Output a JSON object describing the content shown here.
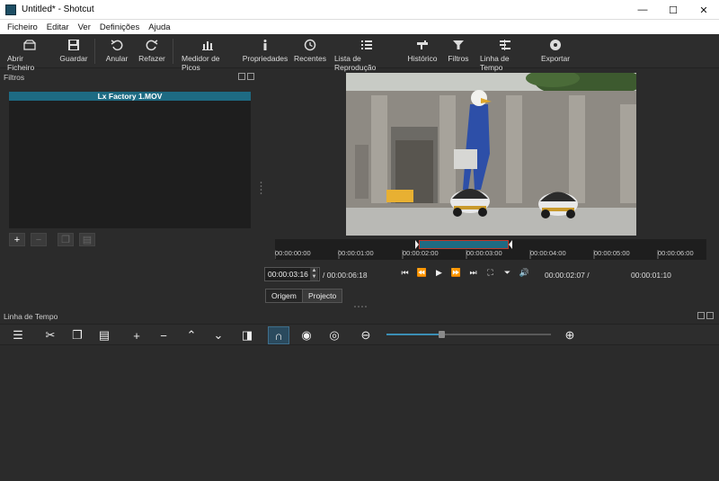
{
  "window": {
    "title": "Untitled* - Shotcut",
    "minimize": "—",
    "maximize": "☐",
    "close": "✕"
  },
  "menu": {
    "items": [
      "Ficheiro",
      "Editar",
      "Ver",
      "Definições",
      "Ajuda"
    ]
  },
  "toolbar": {
    "items": [
      {
        "label": "Abrir Ficheiro",
        "icon": "open-file-icon"
      },
      {
        "label": "Guardar",
        "icon": "save-icon"
      },
      {
        "label": "Anular",
        "icon": "undo-icon"
      },
      {
        "label": "Refazer",
        "icon": "redo-icon"
      },
      {
        "label": "Medidor de Picos",
        "icon": "peak-meter-icon"
      },
      {
        "label": "Propriedades",
        "icon": "properties-icon"
      },
      {
        "label": "Recentes",
        "icon": "recent-icon"
      },
      {
        "label": "Lista de Reprodução",
        "icon": "playlist-icon"
      },
      {
        "label": "Histórico",
        "icon": "history-icon"
      },
      {
        "label": "Filtros",
        "icon": "filter-icon"
      },
      {
        "label": "Linha de Tempo",
        "icon": "timeline-icon"
      },
      {
        "label": "Exportar",
        "icon": "export-icon"
      }
    ]
  },
  "filters_panel": {
    "title": "Filtros",
    "clip_name": "Lx Factory 1.MOV"
  },
  "player": {
    "ruler_labels": [
      "00:00:00:00",
      "00:00:01:00",
      "00:00:02:00",
      "00:00:03:00",
      "00:00:04:00",
      "00:00:05:00",
      "00:00:06:00"
    ],
    "current_time": "00:00:03:16",
    "total_time": "/ 00:00:06:18",
    "in_point": "00:00:02:07 /",
    "duration": "00:00:01:10",
    "tab_source": "Origem",
    "tab_project": "Projecto"
  },
  "timeline_panel": {
    "title": "Linha de Tempo",
    "zoom_level": 0.33
  },
  "colors": {
    "accent": "#1e6b83",
    "background": "#2b2b2b",
    "selection_border": "#c0392b"
  }
}
